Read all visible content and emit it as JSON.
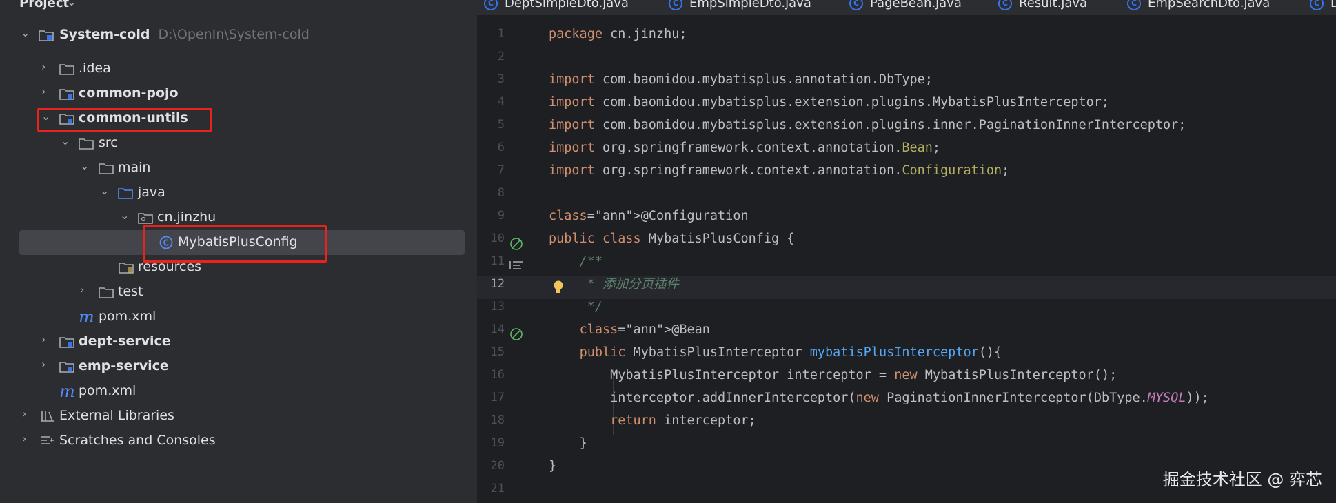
{
  "project": {
    "title": "Project",
    "tree": [
      {
        "label": "System-cold",
        "path": "D:\\OpenIn\\System-cold",
        "bold": true
      },
      {
        "label": ".idea"
      },
      {
        "label": "common-pojo",
        "bold": true
      },
      {
        "label": "common-untils",
        "bold": true
      },
      {
        "label": "src"
      },
      {
        "label": "main"
      },
      {
        "label": "java"
      },
      {
        "label": "cn.jinzhu"
      },
      {
        "label": "MybatisPlusConfig"
      },
      {
        "label": "resources"
      },
      {
        "label": "test"
      },
      {
        "label": "pom.xml"
      },
      {
        "label": "dept-service",
        "bold": true
      },
      {
        "label": "emp-service",
        "bold": true
      },
      {
        "label": "pom.xml"
      },
      {
        "label": "External Libraries"
      },
      {
        "label": "Scratches and Consoles"
      }
    ]
  },
  "tabs": [
    "DeptSimpleDto.java",
    "EmpSimpleDto.java",
    "PageBean.java",
    "Result.java",
    "EmpSearchDto.java",
    "D"
  ],
  "editor": {
    "current_line": 12,
    "line_numbers": [
      "1",
      "2",
      "3",
      "4",
      "5",
      "6",
      "7",
      "8",
      "9",
      "10",
      "11",
      "12",
      "13",
      "14",
      "15",
      "16",
      "17",
      "18",
      "19",
      "20",
      "21"
    ],
    "lines": [
      {
        "t": "package cn.jinzhu;"
      },
      {
        "t": ""
      },
      {
        "t": "import com.baomidou.mybatisplus.annotation.DbType;"
      },
      {
        "t": "import com.baomidou.mybatisplus.extension.plugins.MybatisPlusInterceptor;"
      },
      {
        "t": "import com.baomidou.mybatisplus.extension.plugins.inner.PaginationInnerInterceptor;"
      },
      {
        "t": "import org.springframework.context.annotation.Bean;"
      },
      {
        "t": "import org.springframework.context.annotation.Configuration;"
      },
      {
        "t": ""
      },
      {
        "t": "@Configuration"
      },
      {
        "t": "public class MybatisPlusConfig {"
      },
      {
        "t": "    /**"
      },
      {
        "t": "     * 添加分页插件"
      },
      {
        "t": "     */"
      },
      {
        "t": "    @Bean"
      },
      {
        "t": "    public MybatisPlusInterceptor mybatisPlusInterceptor(){"
      },
      {
        "t": "        MybatisPlusInterceptor interceptor = new MybatisPlusInterceptor();"
      },
      {
        "t": "        interceptor.addInnerInterceptor(new PaginationInnerInterceptor(DbType.MYSQL));"
      },
      {
        "t": "        return interceptor;"
      },
      {
        "t": "    }"
      },
      {
        "t": "}"
      },
      {
        "t": ""
      }
    ]
  },
  "watermark": "掘金技术社区 @ 弈芯",
  "colors": {
    "highlight_box": "#e8221d",
    "keyword": "#cf8e6d",
    "annotation": "#b3ae60",
    "method": "#56a8f5"
  }
}
